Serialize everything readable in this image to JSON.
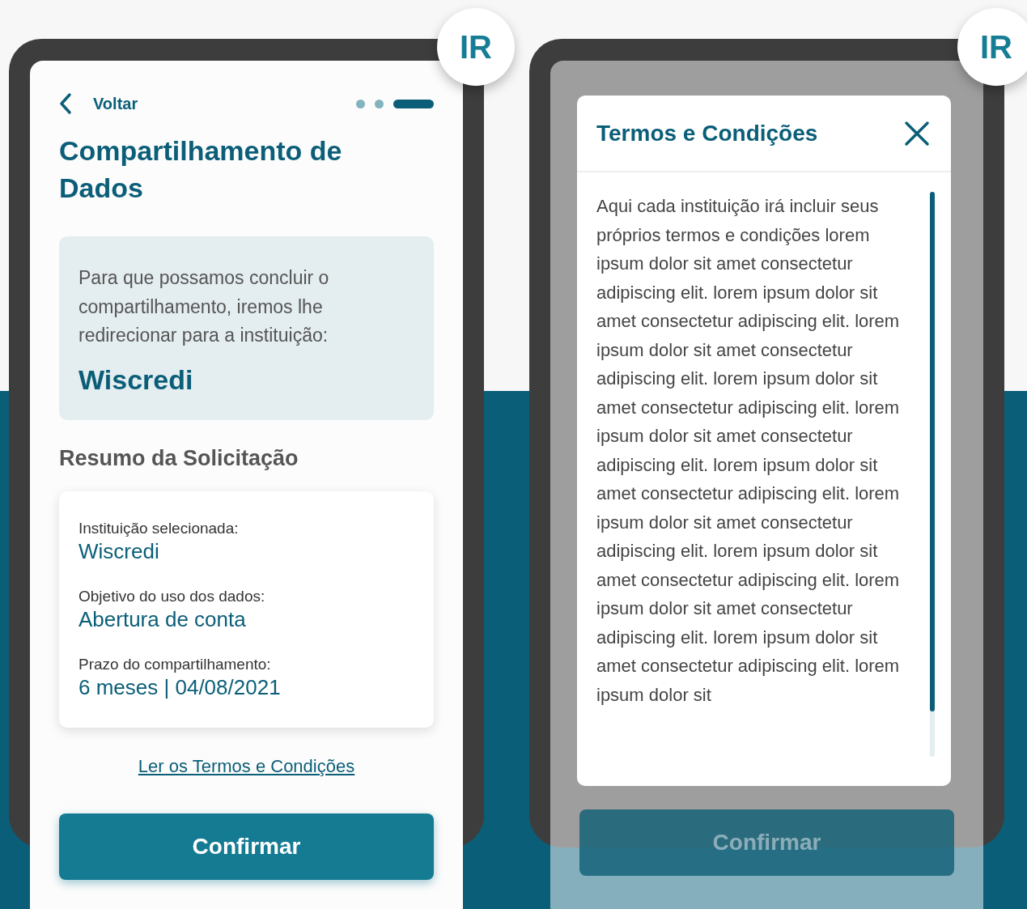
{
  "phones": [
    {
      "badge": "IR",
      "overlay": false,
      "back_label": "Voltar",
      "steps": [
        {
          "selected": false
        },
        {
          "selected": false
        },
        {
          "selected": true
        }
      ],
      "title": "Compartilhamento de Dados",
      "notice": {
        "text": "Para que possamos concluir o compartilhamento, iremos lhe redirecionar para a instituição:",
        "institution": "Wiscredi"
      },
      "summary_heading": "Resumo da Solicitação",
      "summary": [
        {
          "label": "Instituição selecionada:",
          "value": "Wiscredi"
        },
        {
          "label": "Objetivo do uso dos dados:",
          "value": "Abertura de conta"
        },
        {
          "label": "Prazo do compartilhamento:",
          "value": "6 meses | 04/08/2021"
        }
      ],
      "terms_link": "Ler os Termos e Condições",
      "confirm_button": "Confirmar"
    },
    {
      "badge": "IR",
      "overlay": true,
      "confirm_button": "Confirmar",
      "modal": {
        "title": "Termos e Condições",
        "body": "Aqui cada instituição irá incluir seus próprios termos e condições lorem ipsum dolor sit amet consectetur adipiscing elit. lorem ipsum dolor sit amet consectetur adipiscing elit. lorem ipsum dolor sit amet consectetur adipiscing elit. lorem ipsum dolor sit amet consectetur adipiscing elit. lorem ipsum dolor sit amet consectetur adipiscing elit. lorem ipsum dolor sit amet consectetur adipiscing elit. lorem ipsum dolor sit amet consectetur adipiscing elit. lorem ipsum dolor sit amet consectetur adipiscing elit. lorem ipsum dolor sit amet consectetur adipiscing elit. lorem ipsum dolor sit amet consectetur adipiscing elit. lorem ipsum dolor sit"
      }
    }
  ]
}
